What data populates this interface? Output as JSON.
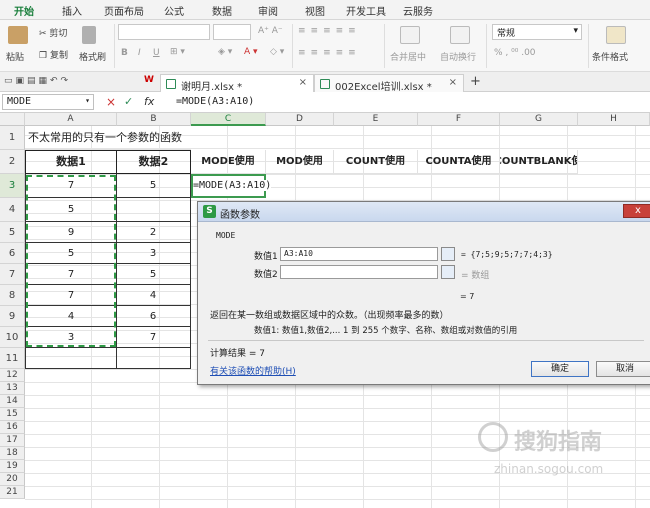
{
  "menu_tabs": [
    "开始",
    "插入",
    "页面布局",
    "公式",
    "数据",
    "审阅",
    "视图",
    "开发工具",
    "云服务"
  ],
  "ribbon": {
    "paste": "粘贴",
    "cut": "剪切",
    "copy": "复制",
    "format_painter": "格式刷",
    "merge_center": "合并居中",
    "wrap_text": "自动换行",
    "number_format": "常规",
    "percent_format": "% ‚ ⁰⁰ .00",
    "conditional_format": "条件格式",
    "font_size_buttons": "A⁺ A⁻",
    "bold": "B",
    "italic": "I",
    "underline": "U"
  },
  "doc_tabs": [
    {
      "label": "谢明月.xlsx *",
      "active": true
    },
    {
      "label": "002Excel培训.xlsx *",
      "active": false
    }
  ],
  "formula_bar": {
    "name_box": "MODE",
    "formula": "=MODE(A3:A10)",
    "fx": "fx",
    "cancel": "×",
    "confirm": "✓"
  },
  "columns": [
    "A",
    "B",
    "C",
    "D",
    "E",
    "F",
    "G",
    "H"
  ],
  "rows": [
    "1",
    "2",
    "3",
    "4",
    "5",
    "6",
    "7",
    "8",
    "9",
    "10",
    "11",
    "12",
    "13",
    "14",
    "15",
    "16",
    "17",
    "18",
    "19",
    "20",
    "21"
  ],
  "sheet": {
    "title": "不太常用的只有一个参数的函数",
    "headers": [
      "数据1",
      "数据2",
      "MODE使用",
      "MOD使用",
      "COUNT使用",
      "COUNTA使用",
      "COUNTBLANK使用"
    ],
    "data1": [
      "7",
      "5",
      "9",
      "5",
      "7",
      "7",
      "4",
      "3"
    ],
    "data2": [
      "5",
      "",
      "2",
      "3",
      "5",
      "4",
      "6",
      "7"
    ],
    "c3_formula": "=MODE(A3:A10)"
  },
  "dialog": {
    "title": "函数参数",
    "function_name": "MODE",
    "arg1_label": "数值1",
    "arg1_value": "A3:A10",
    "arg1_result": "= {7;5;9;5;7;7;4;3}",
    "arg2_label": "数值2",
    "arg2_result": "= 数组",
    "total_result": "= 7",
    "description": "返回在某一数组或数据区域中的众数。（出现频率最多的数）",
    "arg_description": "数值1:  数值1,数值2,... 1 到 255 个数字、名称、数组或对数值的引用",
    "calc_result": "计算结果 = 7",
    "help_link": "有关该函数的帮助(H)",
    "ok": "确定",
    "cancel": "取消"
  },
  "watermark": {
    "text": "搜狗指南",
    "url": "zhinan.sogou.com"
  },
  "colors": {
    "accent": "#1a7f3c",
    "selection_header": "#dfe9d8",
    "dashed_border": "#2e9a45",
    "link": "#1f4fb5"
  }
}
